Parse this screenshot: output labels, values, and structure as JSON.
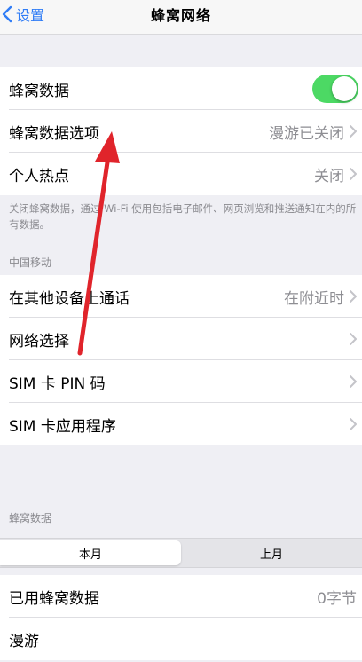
{
  "nav": {
    "back_label": "设置",
    "title": "蜂窝网络"
  },
  "group1": [
    {
      "label": "蜂窝数据",
      "toggle_on": true
    },
    {
      "label": "蜂窝数据选项",
      "value": "漫游已关闭"
    },
    {
      "label": "个人热点",
      "value": "关闭"
    }
  ],
  "note": "关闭蜂窝数据，通过 Wi-Fi 使用包括电子邮件、网页浏览和推送通知在内的所有数据。",
  "carrier_header": "中国移动",
  "group2": [
    {
      "label": "在其他设备上通话",
      "value": "在附近时"
    },
    {
      "label": "网络选择"
    },
    {
      "label": "SIM 卡 PIN 码"
    },
    {
      "label": "SIM 卡应用程序"
    }
  ],
  "usage_header": "蜂窝数据",
  "segmented": {
    "current": "本月",
    "previous": "上月"
  },
  "group3": [
    {
      "label": "已用蜂窝数据",
      "value": "0字节"
    },
    {
      "label": "漫游"
    }
  ],
  "colors": {
    "accent": "#2f7cf6",
    "toggle": "#4cd964",
    "annotation_arrow": "#e0242b"
  }
}
